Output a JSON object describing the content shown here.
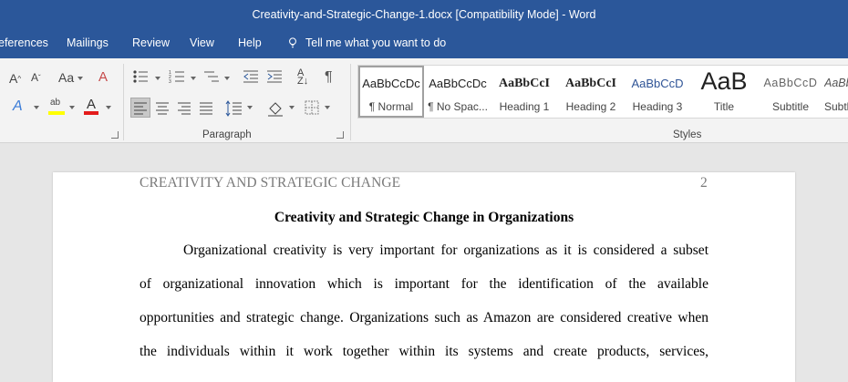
{
  "window": {
    "title": "Creativity-and-Strategic-Change-1.docx [Compatibility Mode]  -  Word"
  },
  "menu": {
    "tabs": [
      "eferences",
      "Mailings",
      "Review",
      "View",
      "Help"
    ],
    "tell_me": "Tell me what you want to do"
  },
  "ribbon": {
    "groups": {
      "paragraph": "Paragraph",
      "styles": "Styles"
    },
    "font_size_label": "Aa",
    "styles": [
      {
        "preview": "AaBbCcDc",
        "name": "¶ Normal"
      },
      {
        "preview": "AaBbCcDc",
        "name": "¶ No Spac..."
      },
      {
        "preview": "AaBbCcI",
        "name": "Heading 1"
      },
      {
        "preview": "AaBbCcI",
        "name": "Heading 2"
      },
      {
        "preview": "AaBbCcD",
        "name": "Heading 3"
      },
      {
        "preview": "AaB",
        "name": "Title"
      },
      {
        "preview": "AaBbCcD",
        "name": "Subtitle"
      },
      {
        "preview": "AaBb",
        "name": "Subtl"
      }
    ],
    "colors": {
      "highlight": "#ffff00",
      "font_color": "#e31b1b",
      "accent": "#2b579a"
    }
  },
  "document": {
    "header": "CREATIVITY AND STRATEGIC CHANGE",
    "page_number": "2",
    "title": "Creativity and Strategic Change in Organizations",
    "lines": [
      "Organizational creativity is very important for organizations as it is considered a subset",
      "of organizational innovation which is important for the identification of the available",
      "opportunities and strategic change. Organizations such as Amazon are considered creative when",
      "the individuals within it work together within its systems and create products, services,"
    ]
  }
}
